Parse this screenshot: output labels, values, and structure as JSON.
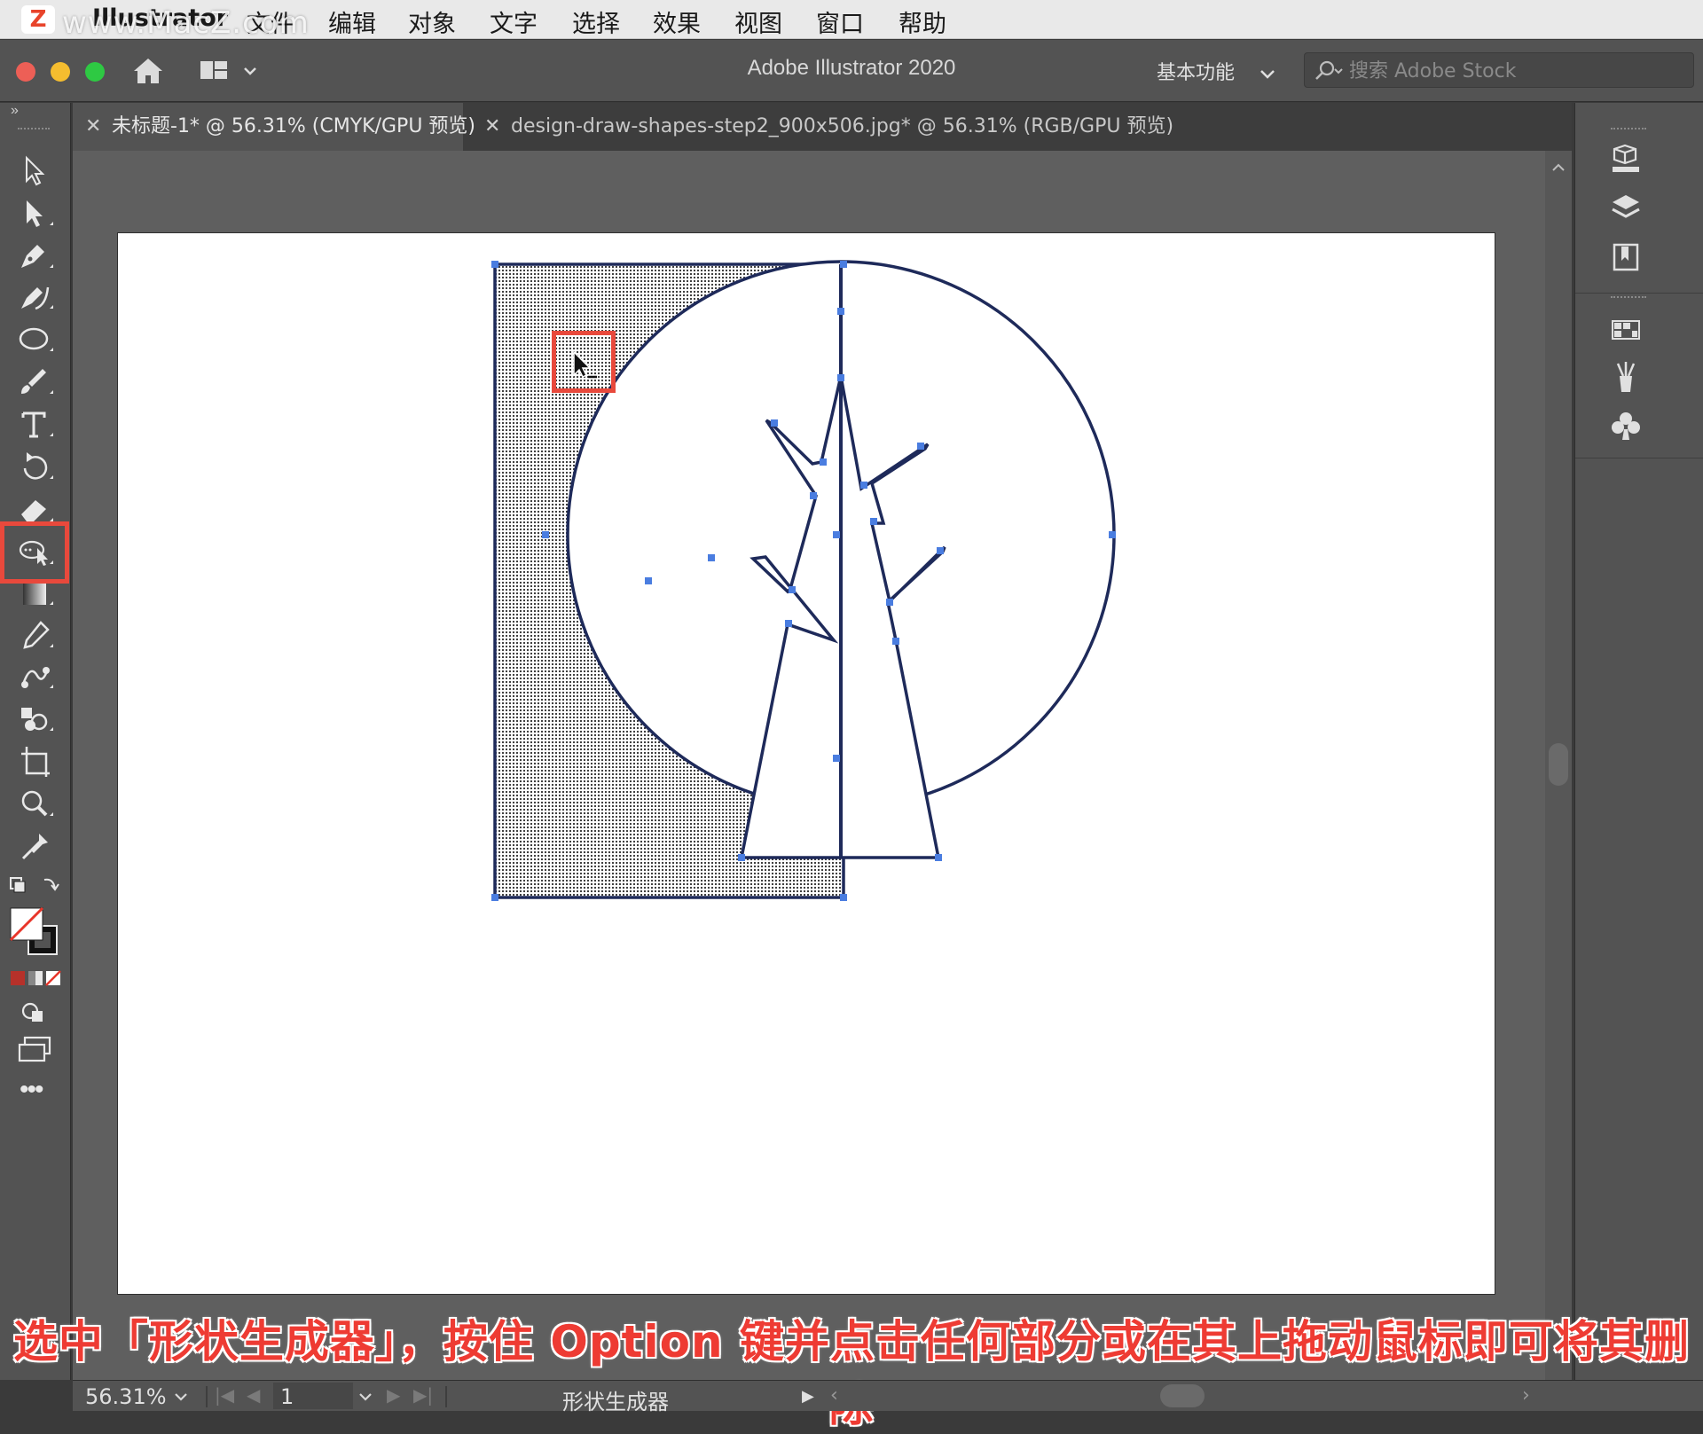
{
  "menubar": {
    "watermark": "www.MacZ.com",
    "items": [
      "Illustrator",
      "文件",
      "编辑",
      "对象",
      "文字",
      "选择",
      "效果",
      "视图",
      "窗口",
      "帮助"
    ]
  },
  "window": {
    "title": "Adobe Illustrator 2020",
    "workspace": "基本功能",
    "stock_placeholder": "搜索 Adobe Stock"
  },
  "tabs": [
    {
      "label": "未标题-1* @ 56.31% (CMYK/GPU 预览)",
      "active": true
    },
    {
      "label": "design-draw-shapes-step2_900x506.jpg* @ 56.31% (RGB/GPU 预览)",
      "active": false
    }
  ],
  "toolbar": {
    "tools": [
      "selection-tool",
      "direct-selection-tool",
      "pen-tool",
      "curvature-tool",
      "ellipse-tool",
      "paintbrush-tool",
      "type-tool",
      "rotate-tool",
      "eraser-tool",
      "shape-builder-tool",
      "gradient-tool",
      "eyedropper-tool",
      "blend-tool",
      "symbol-sprayer-tool",
      "artboard-tool",
      "zoom-tool",
      "puppet-warp-tool"
    ],
    "active_tool": "shape-builder-tool"
  },
  "status": {
    "zoom": "56.31%",
    "artboard_number": "1",
    "current_tool": "形状生成器"
  },
  "caption": "选中「形状生成器」，按住 Option 键并点击任何部分或在其上拖动鼠标即可将其删除",
  "colors": {
    "highlight": "#e8493c",
    "path_stroke": "#1e2a5a",
    "anchor": "#4a7de0",
    "caption_text": "#ee3b33"
  }
}
